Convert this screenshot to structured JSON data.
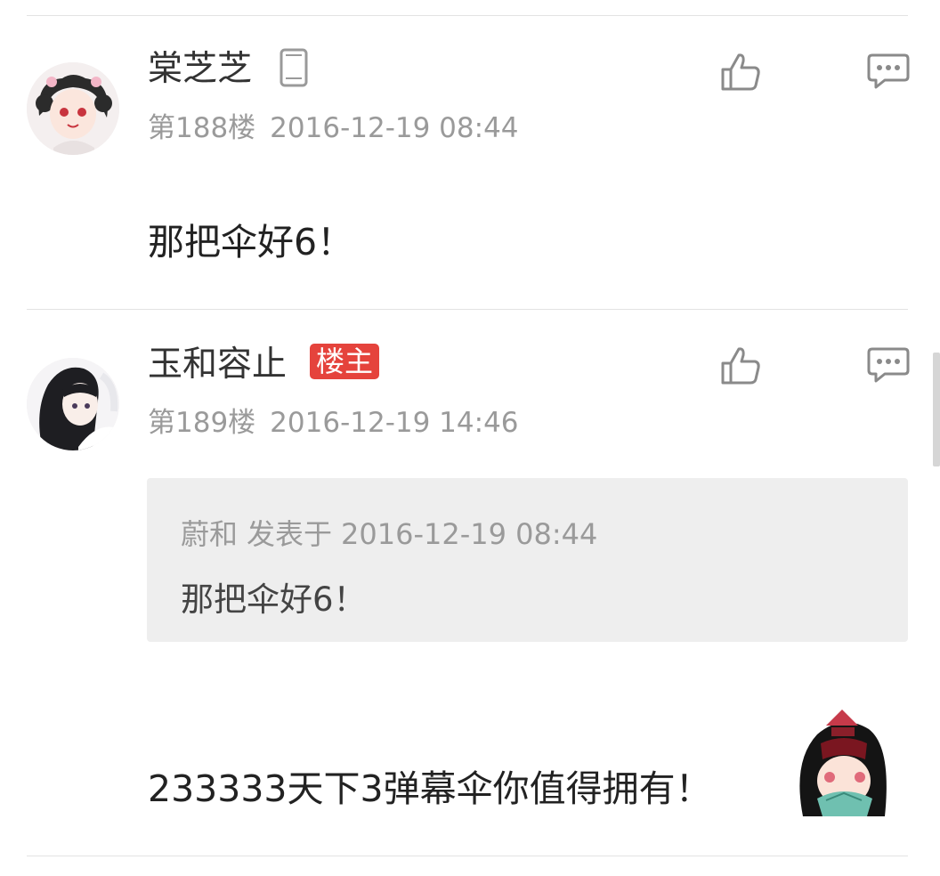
{
  "posts": [
    {
      "username": "棠芝芝",
      "device_icon": "phone-icon",
      "floor": "第188楼",
      "time": "2016-12-19 08:44",
      "content": "那把伞好6！"
    },
    {
      "username": "玉和容止",
      "badge": "楼主",
      "floor": "第189楼",
      "time": "2016-12-19 14:46",
      "quote": {
        "author": "蔚和",
        "action": "发表于",
        "time": "2016-12-19 08:44",
        "content": "那把伞好6！"
      },
      "content": "233333天下3弹幕伞你值得拥有！"
    }
  ],
  "colors": {
    "badge": "#e5433c",
    "meta_text": "#9a9a9a",
    "quote_bg": "#eeeeee",
    "icon_stroke": "#8a8a8a"
  },
  "icons": {
    "like": "thumbs-up-icon",
    "reply": "comment-icon"
  }
}
